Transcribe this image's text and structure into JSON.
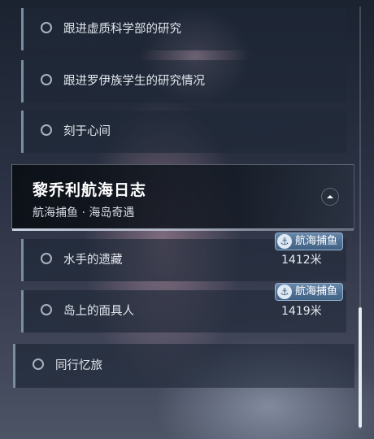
{
  "quests_top": [
    {
      "label": "跟进虚质科学部的研究"
    },
    {
      "label": "跟进罗伊族学生的研究情况"
    },
    {
      "label": "刻于心间"
    }
  ],
  "group": {
    "title": "黎乔利航海日志",
    "subtitle": "航海捕鱼 · 海岛奇遇",
    "collapse_icon": "chevron-up-icon"
  },
  "quests_group": [
    {
      "label": "水手的遗藏",
      "tag": "航海捕鱼",
      "distance": "1412米"
    },
    {
      "label": "岛上的面具人",
      "tag": "航海捕鱼",
      "distance": "1419米"
    }
  ],
  "quest_bottom": {
    "label": "同行忆旅"
  },
  "icons": {
    "tag_icon": "anchor-icon",
    "quest_icon": "circle-icon"
  }
}
